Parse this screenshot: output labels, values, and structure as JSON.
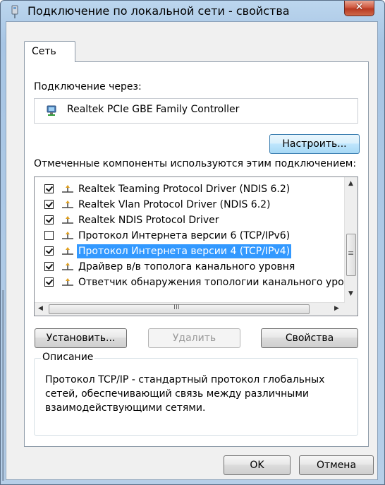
{
  "window": {
    "title": "Подключение по локальной сети - свойства"
  },
  "tabs": [
    {
      "label": "Сеть"
    }
  ],
  "connect_using": {
    "label": "Подключение через:",
    "adapter": "Realtek PCIe GBE Family Controller",
    "configure_button": "Настроить..."
  },
  "components": {
    "label": "Отмеченные компоненты используются этим подключением:",
    "items": [
      {
        "label": "Realtek Teaming Protocol Driver (NDIS 6.2)",
        "checked": true,
        "selected": false
      },
      {
        "label": "Realtek Vlan Protocol Driver (NDIS 6.2)",
        "checked": true,
        "selected": false
      },
      {
        "label": "Realtek NDIS Protocol Driver",
        "checked": true,
        "selected": false
      },
      {
        "label": "Протокол Интернета версии 6 (TCP/IPv6)",
        "checked": false,
        "selected": false
      },
      {
        "label": "Протокол Интернета версии 4 (TCP/IPv4)",
        "checked": true,
        "selected": true
      },
      {
        "label": "Драйвер в/в тополога канального уровня",
        "checked": true,
        "selected": false
      },
      {
        "label": "Ответчик обнаружения топологии канального уров",
        "checked": true,
        "selected": false
      }
    ],
    "hscroll_grip": "III",
    "vscroll_grip": "≡"
  },
  "buttons": {
    "install": "Установить...",
    "uninstall": "Удалить",
    "properties": "Свойства",
    "ok": "OK",
    "cancel": "Отмена"
  },
  "description": {
    "title": "Описание",
    "text": "Протокол TCP/IP - стандартный протокол глобальных сетей, обеспечивающий связь между различными взаимодействующими сетями."
  },
  "icons": {
    "title": "network-connection-icon",
    "adapter": "network-adapter-icon",
    "protocol": "network-protocol-icon"
  },
  "colors": {
    "selection": "#3399ff",
    "close": "#c8452c"
  }
}
